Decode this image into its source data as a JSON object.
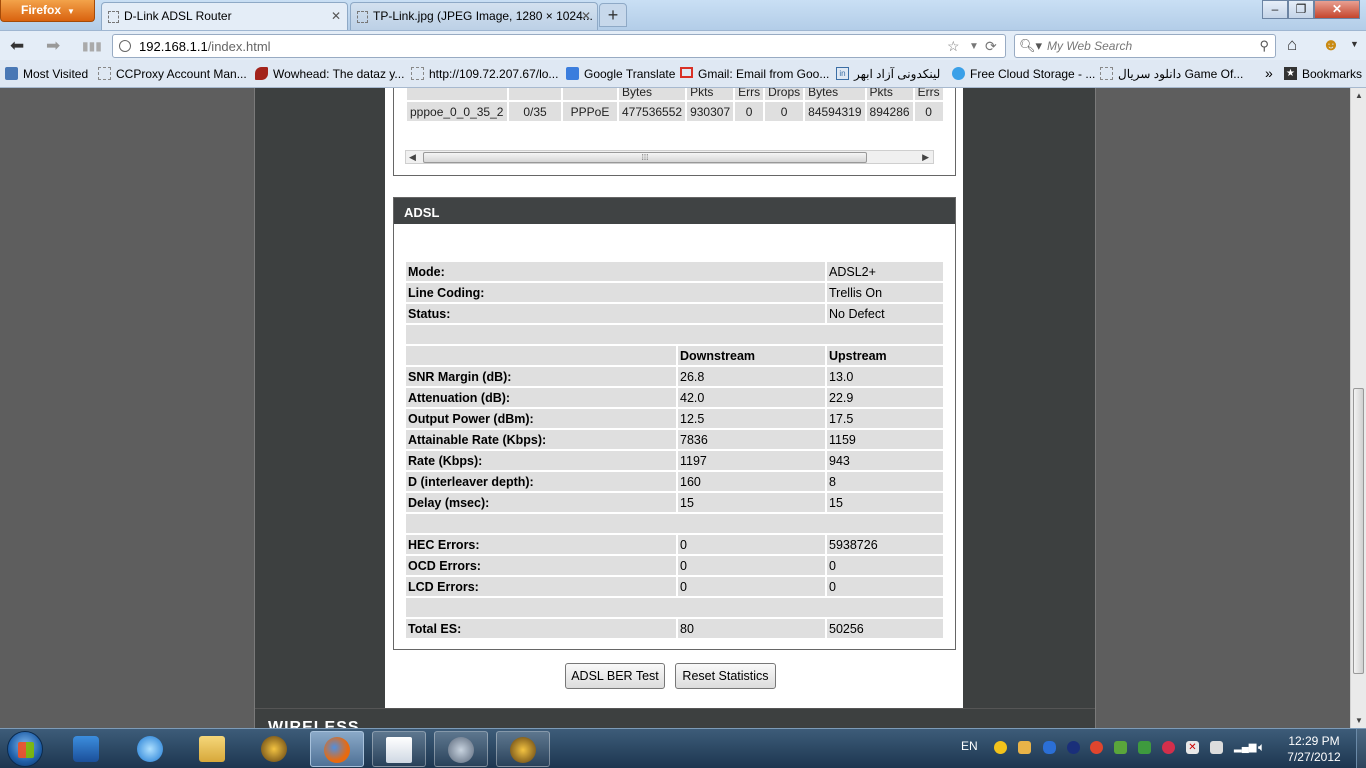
{
  "browser": {
    "app_button": "Firefox",
    "tabs": [
      {
        "title": "D-Link ADSL Router",
        "active": true
      },
      {
        "title": "TP-Link.jpg (JPEG Image, 1280 × 1024...",
        "active": false
      }
    ],
    "new_tab": "+",
    "url_host": "192.168.1.1",
    "url_path": "/index.html",
    "search_placeholder": "My Web Search",
    "bookmarks": [
      {
        "label": "Most Visited",
        "icon": "most-visited-icon"
      },
      {
        "label": "CCProxy Account Man...",
        "icon": "blank-page-icon"
      },
      {
        "label": "Wowhead: The dataz y...",
        "icon": "wowhead-icon"
      },
      {
        "label": "http://109.72.207.67/lo...",
        "icon": "blank-page-icon"
      },
      {
        "label": "Google Translate",
        "icon": "translate-icon"
      },
      {
        "label": "Gmail: Email from Goo...",
        "icon": "gmail-icon"
      },
      {
        "label": "لینکدونی آزاد ابهر",
        "icon": "link-icon"
      },
      {
        "label": "Free Cloud Storage - ...",
        "icon": "cloud-icon"
      },
      {
        "label": "دانلود سریال Game Of...",
        "icon": "blank-page-icon"
      },
      {
        "label": "»",
        "icon": "chevron-icon"
      },
      {
        "label": "Bookmarks",
        "icon": "bookmarks-star-icon"
      }
    ]
  },
  "wan_table": {
    "header_fragments": [
      "",
      "",
      "",
      "Bytes",
      "Pkts",
      "Errs",
      "Drops",
      "Bytes",
      "Pkts",
      "Errs"
    ],
    "row": [
      "pppoe_0_0_35_2",
      "0/35",
      "PPPoE",
      "477536552",
      "930307",
      "0",
      "0",
      "84594319",
      "894286",
      "0"
    ]
  },
  "adsl": {
    "title": "ADSL",
    "mode_label": "Mode:",
    "mode_value": "ADSL2+",
    "line_coding_label": "Line Coding:",
    "line_coding_value": "Trellis On",
    "status_label": "Status:",
    "status_value": "No Defect",
    "col_downstream": "Downstream",
    "col_upstream": "Upstream",
    "stats": [
      {
        "label": "SNR Margin (dB):",
        "down": "26.8",
        "up": "13.0"
      },
      {
        "label": "Attenuation (dB):",
        "down": "42.0",
        "up": "22.9"
      },
      {
        "label": "Output Power (dBm):",
        "down": "12.5",
        "up": "17.5"
      },
      {
        "label": "Attainable Rate (Kbps):",
        "down": "7836",
        "up": "1159"
      },
      {
        "label": "Rate (Kbps):",
        "down": "1197",
        "up": "943"
      },
      {
        "label": "D (interleaver depth):",
        "down": "160",
        "up": "8"
      },
      {
        "label": "Delay (msec):",
        "down": "15",
        "up": "15"
      }
    ],
    "errors": [
      {
        "label": "HEC Errors:",
        "down": "0",
        "up": "5938726"
      },
      {
        "label": "OCD Errors:",
        "down": "0",
        "up": "0"
      },
      {
        "label": "LCD Errors:",
        "down": "0",
        "up": "0"
      }
    ],
    "total": {
      "label": "Total ES:",
      "down": "80",
      "up": "50256"
    },
    "ber_button": "ADSL BER Test",
    "reset_button": "Reset Statistics"
  },
  "next_section": "WIRELESS",
  "taskbar": {
    "language": "EN",
    "time": "12:29 PM",
    "date": "7/27/2012"
  },
  "colors": {
    "section_header": "#404344",
    "page_frame": "#3d4040",
    "table_cell": "#dfdfdf"
  }
}
